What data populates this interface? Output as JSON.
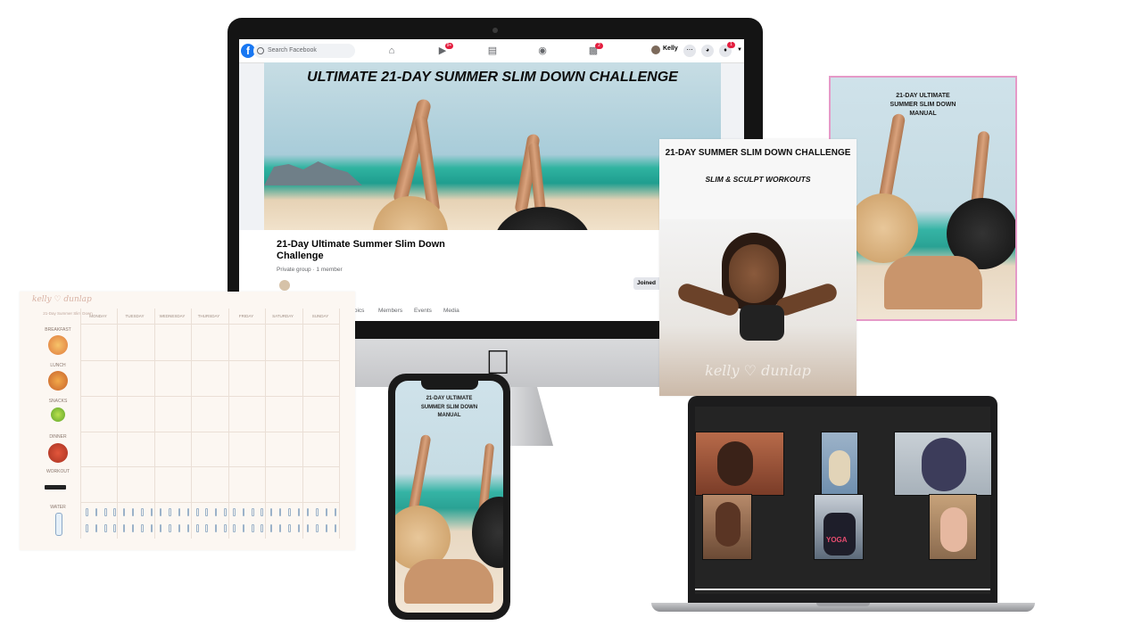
{
  "facebook": {
    "search_placeholder": "Search Facebook",
    "user_name": "Kelly",
    "watch_badge": "9+",
    "groups_badge": "2",
    "notifications_badge": "1",
    "cover_title": "ULTIMATE 21-DAY SUMMER SLIM DOWN CHALLENGE",
    "group_name": "21-Day Ultimate Summer Slim Down Challenge",
    "group_meta": "Private group · 1 member",
    "joined_label": "Joined",
    "tabs": [
      "Topics",
      "Members",
      "Events",
      "Media"
    ]
  },
  "planner": {
    "logo": "kelly ♡ dunlap",
    "subtitle": "21-Day Summer Slim Down",
    "days": [
      "MONDAY",
      "TUESDAY",
      "WEDNESDAY",
      "THURSDAY",
      "FRIDAY",
      "SATURDAY",
      "SUNDAY"
    ],
    "rows": [
      "BREAKFAST",
      "LUNCH",
      "SNACKS",
      "DINNER",
      "WORKOUT",
      "WATER"
    ]
  },
  "workbook": {
    "title": "21-DAY SUMMER SLIM DOWN CHALLENGE",
    "subtitle": "SLIM & SCULPT WORKOUTS",
    "logo": "kelly ♡ dunlap"
  },
  "manual": {
    "title_line1": "21-DAY ULTIMATE",
    "title_line2": "SUMMER SLIM DOWN",
    "title_line3": "MANUAL"
  },
  "phone": {
    "title_line1": "21-DAY ULTIMATE",
    "title_line2": "SUMMER SLIM DOWN",
    "title_line3": "MANUAL"
  },
  "laptop": {
    "video_call_label": "",
    "shirt_text": "YOGA"
  },
  "colors": {
    "facebook_blue": "#1877f2",
    "badge_red": "#e41e3f",
    "manual_border": "#e59ac8",
    "planner_bg": "#fcf7f2"
  }
}
